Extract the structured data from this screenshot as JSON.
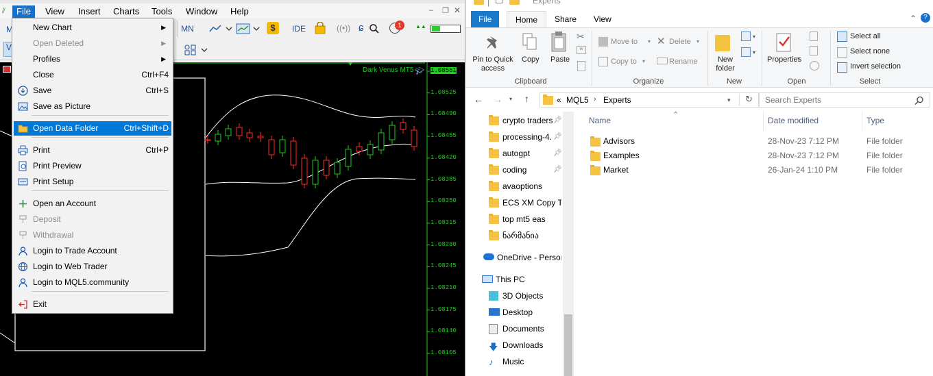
{
  "mt5": {
    "menu": [
      "File",
      "View",
      "Insert",
      "Charts",
      "Tools",
      "Window",
      "Help"
    ],
    "toolbar": {
      "mn_label": "MN",
      "ide_label": "IDE",
      "notification_badge": "1",
      "left_clip_1": "M",
      "left_clip_2": "V"
    },
    "chart": {
      "title": "Dark Venus MT5",
      "price_labels": [
        "1.08561",
        "1.08525",
        "1.08490",
        "1.08455",
        "1.08420",
        "1.08385",
        "1.08350",
        "1.08315",
        "1.08280",
        "1.08245",
        "1.08210",
        "1.08175",
        "1.08140",
        "1.08105"
      ]
    },
    "file_menu": {
      "items": [
        {
          "label": "New Chart",
          "shortcut": "",
          "submenu": true,
          "disabled": false,
          "icon": ""
        },
        {
          "label": "Open Deleted",
          "shortcut": "",
          "submenu": true,
          "disabled": true,
          "icon": ""
        },
        {
          "label": "Profiles",
          "shortcut": "",
          "submenu": true,
          "disabled": false,
          "icon": ""
        },
        {
          "label": "Close",
          "shortcut": "Ctrl+F4",
          "submenu": false,
          "disabled": false,
          "icon": ""
        },
        {
          "label": "Save",
          "shortcut": "Ctrl+S",
          "submenu": false,
          "disabled": false,
          "icon": "save-icon"
        },
        {
          "label": "Save as Picture",
          "shortcut": "",
          "submenu": false,
          "disabled": false,
          "icon": "picture-icon"
        },
        {
          "label": "Open Data Folder",
          "shortcut": "Ctrl+Shift+D",
          "submenu": false,
          "disabled": false,
          "icon": "folder-icon",
          "selected": true
        },
        {
          "label": "Print",
          "shortcut": "Ctrl+P",
          "submenu": false,
          "disabled": false,
          "icon": "print-icon"
        },
        {
          "label": "Print Preview",
          "shortcut": "",
          "submenu": false,
          "disabled": false,
          "icon": "print-preview-icon"
        },
        {
          "label": "Print Setup",
          "shortcut": "",
          "submenu": false,
          "disabled": false,
          "icon": "print-setup-icon"
        },
        {
          "label": "Open an Account",
          "shortcut": "",
          "submenu": false,
          "disabled": false,
          "icon": "plus-icon"
        },
        {
          "label": "Deposit",
          "shortcut": "",
          "submenu": false,
          "disabled": true,
          "icon": "deposit-icon"
        },
        {
          "label": "Withdrawal",
          "shortcut": "",
          "submenu": false,
          "disabled": true,
          "icon": "withdrawal-icon"
        },
        {
          "label": "Login to Trade Account",
          "shortcut": "",
          "submenu": false,
          "disabled": false,
          "icon": "user-icon"
        },
        {
          "label": "Login to Web Trader",
          "shortcut": "",
          "submenu": false,
          "disabled": false,
          "icon": "globe-icon"
        },
        {
          "label": "Login to MQL5.community",
          "shortcut": "",
          "submenu": false,
          "disabled": false,
          "icon": "user-icon"
        },
        {
          "label": "Exit",
          "shortcut": "",
          "submenu": false,
          "disabled": false,
          "icon": "exit-icon"
        }
      ]
    }
  },
  "explorer": {
    "title_clip": "Experts",
    "tabs": [
      "File",
      "Home",
      "Share",
      "View"
    ],
    "ribbon": {
      "clipboard": {
        "pin": "Pin to Quick access",
        "copy": "Copy",
        "paste": "Paste",
        "group": "Clipboard"
      },
      "organize": {
        "move_to": "Move to",
        "copy_to": "Copy to",
        "delete": "Delete",
        "rename": "Rename",
        "group": "Organize"
      },
      "new": {
        "new_folder": "New folder",
        "group": "New"
      },
      "open": {
        "properties": "Properties",
        "group": "Open"
      },
      "select": {
        "select_all": "Select all",
        "select_none": "Select none",
        "invert": "Invert selection",
        "group": "Select"
      }
    },
    "address": {
      "overflow": "«",
      "crumbs": [
        "MQL5",
        "Experts"
      ],
      "search_placeholder": "Search Experts"
    },
    "nav": [
      {
        "label": "crypto traders",
        "pinned": true,
        "type": "folder"
      },
      {
        "label": "processing-4.",
        "pinned": true,
        "type": "folder"
      },
      {
        "label": "autogpt",
        "pinned": true,
        "type": "folder"
      },
      {
        "label": "coding",
        "pinned": true,
        "type": "folder"
      },
      {
        "label": "avaoptions",
        "pinned": false,
        "type": "folder"
      },
      {
        "label": "ECS XM Copy Tra",
        "pinned": false,
        "type": "folder"
      },
      {
        "label": "top mt5 eas",
        "pinned": false,
        "type": "folder"
      },
      {
        "label": "ნარმანია",
        "pinned": false,
        "type": "folder"
      },
      {
        "label": "OneDrive - Person",
        "pinned": false,
        "type": "onedrive"
      },
      {
        "label": "This PC",
        "pinned": false,
        "type": "pc"
      },
      {
        "label": "3D Objects",
        "pinned": false,
        "type": "3d"
      },
      {
        "label": "Desktop",
        "pinned": false,
        "type": "desktop"
      },
      {
        "label": "Documents",
        "pinned": false,
        "type": "documents"
      },
      {
        "label": "Downloads",
        "pinned": false,
        "type": "downloads"
      },
      {
        "label": "Music",
        "pinned": false,
        "type": "music"
      }
    ],
    "columns": {
      "name": "Name",
      "date": "Date modified",
      "type": "Type"
    },
    "files": [
      {
        "name": "Advisors",
        "date": "28-Nov-23 7:12 PM",
        "type": "File folder"
      },
      {
        "name": "Examples",
        "date": "28-Nov-23 7:12 PM",
        "type": "File folder"
      },
      {
        "name": "Market",
        "date": "26-Jan-24 1:10 PM",
        "type": "File folder"
      }
    ]
  }
}
